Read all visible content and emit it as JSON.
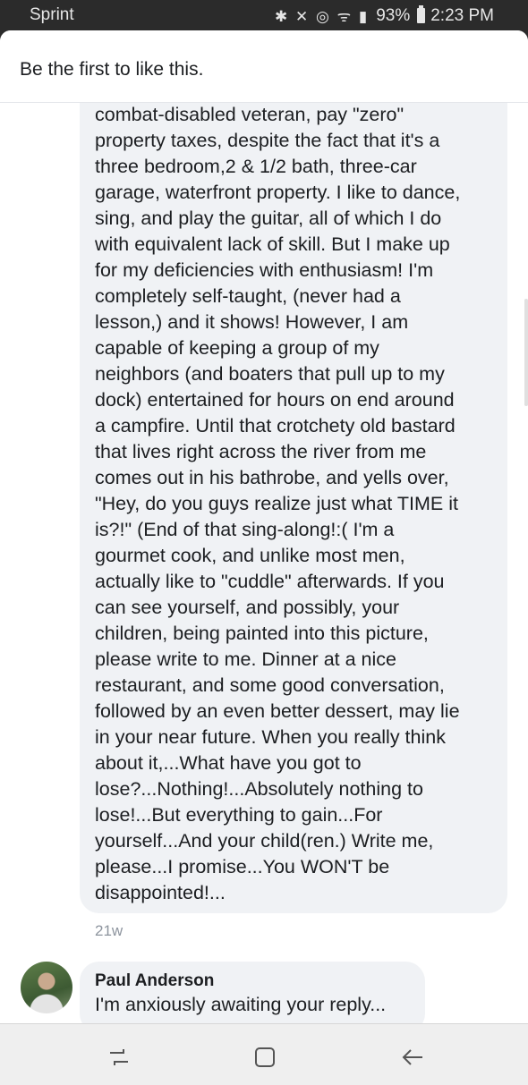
{
  "status_bar": {
    "carrier": "Sprint",
    "icons": [
      "bluetooth-icon",
      "mute-icon",
      "alarm-icon",
      "wifi-icon",
      "signal-icon"
    ],
    "battery": "93%",
    "time": "2:23 PM"
  },
  "likes": {
    "text": "Be the first to like this."
  },
  "comment": {
    "lines": [
      "combat-disabled veteran, pay \"zero\"",
      "property taxes, despite the fact that it's a",
      "three bedroom,2 & 1/2 bath, three-car",
      "garage, waterfront property. I like to dance,",
      "sing, and play the guitar, all of which I do",
      "with equivalent lack of skill.  But I make up",
      "for my deficiencies with enthusiasm!  I'm",
      "completely self-taught, (never had a",
      "lesson,) and it shows!  However, I am",
      "capable of keeping a group of my",
      "neighbors (and boaters that pull up to my",
      "dock) entertained for hours on end around",
      "a campfire.  Until that crotchety old bastard",
      "that lives right across the river from me",
      "comes out in his bathrobe, and yells over,",
      "\"Hey, do you guys realize just what TIME it",
      "is?!\"  (End of that sing-along!:(  I'm a",
      "gourmet cook, and unlike most men,",
      "actually like to \"cuddle\" afterwards.  If you",
      "can see yourself, and possibly, your",
      "children, being painted into this picture,",
      "please write to me.  Dinner at a nice",
      "restaurant, and some good conversation,",
      "followed by an even better dessert, may lie",
      "in your near future.  When you really think",
      "about it,...What have you got to",
      "lose?...Nothing!...Absolutely nothing to",
      "lose!...But everything to gain...For",
      "yourself...And your child(ren.)  Write me,",
      "please...I promise...You WON'T be",
      "disappointed!..."
    ],
    "time": "21w"
  },
  "reply": {
    "author": "Paul Anderson",
    "text": "I'm anxiously awaiting your reply..."
  },
  "nav": {
    "icons": [
      "recent-apps-icon",
      "home-icon",
      "back-icon"
    ]
  },
  "colors": {
    "bubble": "#f0f2f5",
    "text": "#1c1e21",
    "meta": "#8d949e",
    "status_bar": "#2b2b2b"
  }
}
